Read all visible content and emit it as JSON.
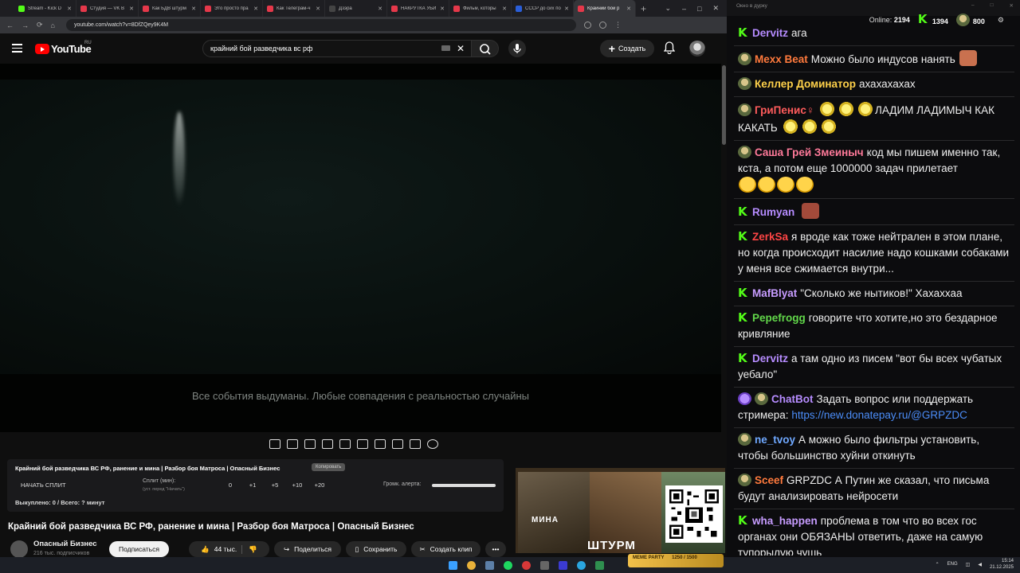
{
  "browser": {
    "tabs": [
      {
        "label": "Stream - Kick D",
        "color": "#53fc18"
      },
      {
        "label": "Студия — VK В",
        "color": "#e5384a"
      },
      {
        "label": "Как БДВ штурм",
        "color": "#e5384a"
      },
      {
        "label": "Это просто пра",
        "color": "#e5384a"
      },
      {
        "label": "Как Телеграм-ч",
        "color": "#e5384a"
      },
      {
        "label": "Дзэра",
        "color": "#444"
      },
      {
        "label": "НАКРУТКА УБИ",
        "color": "#e5384a"
      },
      {
        "label": "Фильм, которы",
        "color": "#e5384a"
      },
      {
        "label": "СССР до сих по",
        "color": "#2a5ed8"
      },
      {
        "label": "Крайний бой р",
        "color": "#e5384a",
        "active": true
      }
    ],
    "url": "youtube.com/watch?v=8DfZQey9K4M"
  },
  "youtube": {
    "logo_text": "YouTube",
    "logo_region": "RU",
    "search_value": "крайний бой разведчика вс рф",
    "create_label": "Создать",
    "subtitle": "Все события выдуманы. Любые совпадения с реальностью случайны",
    "video_title": "Крайний бой разведчика ВС РФ, ранение и мина | Разбор боя Матроса | Опасный Бизнес",
    "channel_name": "Опасный Бизнес",
    "channel_subs": "216 тыс. подписчиков",
    "subscribe_label": "Подписаться",
    "likes_label": "44 тыс.",
    "share_label": "Поделиться",
    "save_label": "Сохранить",
    "clip_label": "Создать клип",
    "more_label": "•••"
  },
  "extension": {
    "title": "Крайний бой разведчика ВС РФ, ранение и мина | Разбор боя Матроса | Опасный Бизнес",
    "copy_label": "Копировать",
    "split_label": "НАЧАТЬ СПЛИТ",
    "split_min_label": "Сплит (мин):",
    "split_hint": "(уст. перед \"Начать\")",
    "split_values": [
      "0",
      "+1",
      "+5",
      "+10",
      "+20"
    ],
    "alert_volume_label": "Громк. алерта:",
    "bought_text": "Выкуплено: 0 / Всего: ? минут"
  },
  "thumbnail": {
    "mina_text": "МИНА",
    "shturm_text": "ШТУРМ"
  },
  "chat": {
    "window_title": "Окно в дурку",
    "online_label": "Online:",
    "online_count": "2194",
    "kick_count": "1394",
    "badge_count": "800",
    "messages": [
      {
        "badge": "kick",
        "user": "Dervitz",
        "color": "#b68cff",
        "text": "ага"
      },
      {
        "badge": "dot",
        "user": "Mexx Beat",
        "color": "#ff7a3d",
        "text": "Можно было индусов нанять",
        "emote": "#c9714f"
      },
      {
        "badge": "dot",
        "user": "Келлер Доминатор",
        "color": "#ffd14a",
        "text": "ахахахахах"
      },
      {
        "badge": "dot",
        "user": "ГриПенис♀",
        "color": "#ff5c5c",
        "text": "ЛАДИМ ЛАДИМЫЧ КАК КАКАТЬ"
      },
      {
        "badge": "dot",
        "user": "Саша Грей Змеиныч",
        "color": "#ff7a9a",
        "text": "код мы пишем именно так, кста, а потом еще 1000000 задач прилетает"
      },
      {
        "badge": "kick",
        "user": "Rumyan",
        "color": "#b68cff",
        "text": "",
        "emote": "#a34a3a"
      },
      {
        "badge": "kick",
        "user": "ZerkSa",
        "color": "#ff4545",
        "text": "я вроде как тоже нейтрален в этом плане, но когда происходит насилие надо кошками собаками у меня все сжимается внутри..."
      },
      {
        "badge": "kick",
        "user": "MafBlyat",
        "color": "#c79cff",
        "text": "\"Сколько же нытиков!\" Хахаххаа"
      },
      {
        "badge": "kick",
        "user": "Pepefrogg",
        "color": "#62d84a",
        "text": "говорите что хотите,но это бездарное кривляние"
      },
      {
        "badge": "kick",
        "user": "Dervitz",
        "color": "#b68cff",
        "text": "а там одно из писем \"вот бы всех чубатых уебало\""
      },
      {
        "badge": "bot",
        "user": "ChatBot",
        "color": "#b68cff",
        "text": "Задать вопрос или поддержать стримера:",
        "link": "https://new.donatepay.ru/@GRPZDC"
      },
      {
        "badge": "dot",
        "user": "ne_tvoy",
        "color": "#6fa8ff",
        "text": "А можно было фильтры установить, чтобы большинство хуйни откинуть"
      },
      {
        "badge": "dot",
        "user": "Sceef",
        "color": "#ff7a3d",
        "text": "GRPZDC А Путин же сказал, что письма будут анализировать нейросети"
      },
      {
        "badge": "kick",
        "user": "wha_happen",
        "color": "#c79cff",
        "text": "проблема в том что во всех гос органах они ОБЯЗАНЫ ответить, даже на самую тупорылую чушь"
      }
    ]
  },
  "taskbar": {
    "meme_label": "MEME PARTY",
    "meme_progress": "1250 / 1500",
    "lang": "ENG",
    "time": "15:14",
    "date": "21.12.2025"
  }
}
